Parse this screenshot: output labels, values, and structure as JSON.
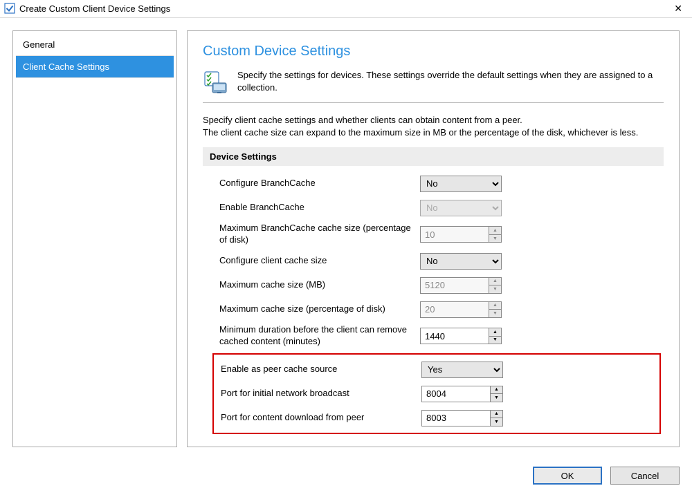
{
  "window_title": "Create Custom Client Device Settings",
  "close_label": "✕",
  "sidebar": {
    "items": [
      {
        "label": "General",
        "selected": false
      },
      {
        "label": "Client Cache Settings",
        "selected": true
      }
    ]
  },
  "main": {
    "title": "Custom Device Settings",
    "intro": "Specify the settings for devices. These settings override the default settings when they are assigned to a collection.",
    "description_line1": "Specify client cache settings and whether clients can obtain content from a peer.",
    "description_line2": "The client cache size can expand to the maximum size in MB or the percentage of the disk, whichever is less.",
    "section_header": "Device Settings",
    "settings": [
      {
        "label": "Configure BranchCache",
        "type": "combo",
        "value": "No",
        "disabled": false
      },
      {
        "label": "Enable BranchCache",
        "type": "combo",
        "value": "No",
        "disabled": true
      },
      {
        "label": "Maximum BranchCache cache size (percentage of disk)",
        "type": "spinner",
        "value": "10",
        "disabled": true
      },
      {
        "label": "Configure client cache size",
        "type": "combo",
        "value": "No",
        "disabled": false
      },
      {
        "label": "Maximum cache size (MB)",
        "type": "spinner",
        "value": "5120",
        "disabled": true
      },
      {
        "label": "Maximum cache size (percentage of disk)",
        "type": "spinner",
        "value": "20",
        "disabled": true
      },
      {
        "label": "Minimum duration before the client can remove cached content (minutes)",
        "type": "spinner",
        "value": "1440",
        "disabled": false
      }
    ],
    "highlighted_settings": [
      {
        "label": "Enable as peer cache source",
        "type": "combo",
        "value": "Yes",
        "disabled": false
      },
      {
        "label": "Port for initial network broadcast",
        "type": "spinner",
        "value": "8004",
        "disabled": false
      },
      {
        "label": "Port for content download from peer",
        "type": "spinner",
        "value": "8003",
        "disabled": false
      }
    ]
  },
  "buttons": {
    "ok": "OK",
    "cancel": "Cancel"
  },
  "spinner_glyphs": {
    "up": "▲",
    "down": "▼"
  }
}
